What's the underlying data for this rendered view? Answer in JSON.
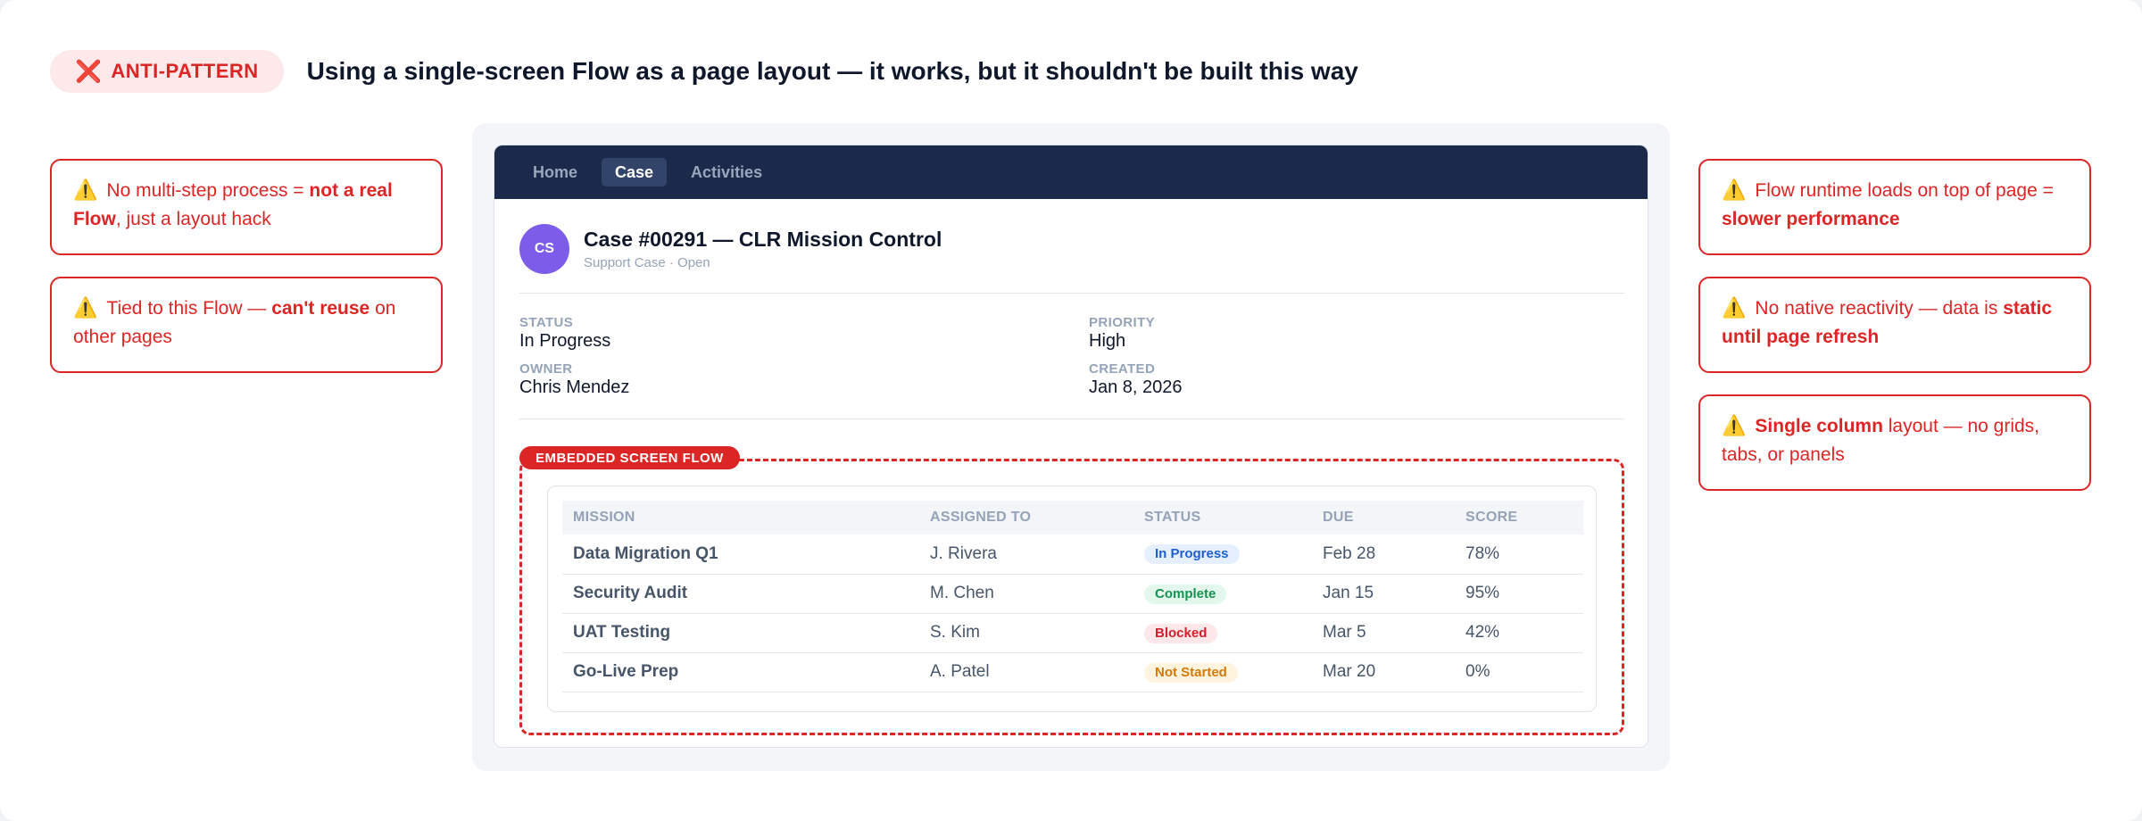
{
  "header": {
    "badge_icon": "❌",
    "badge_label": "ANTI-PATTERN",
    "title": "Using a single-screen Flow as a page layout — it works, but it shouldn't be built this way"
  },
  "warn_icon": "⚠️",
  "callouts_left": [
    {
      "pre": "No multi-step process = ",
      "bold": "not a real Flow",
      "post": ", just a layout hack"
    },
    {
      "pre": "Tied to this Flow — ",
      "bold": "can't reuse",
      "post": " on other pages"
    }
  ],
  "callouts_right": [
    {
      "pre": "Flow runtime loads on top of page = ",
      "bold": "slower performance",
      "post": ""
    },
    {
      "pre": "No native reactivity — data is ",
      "bold": "static until page refresh",
      "post": ""
    },
    {
      "pre": "",
      "bold": "Single column",
      "post": " layout — no grids, tabs, or panels"
    }
  ],
  "nav": {
    "tabs": [
      {
        "label": "Home",
        "active": false
      },
      {
        "label": "Case",
        "active": true
      },
      {
        "label": "Activities",
        "active": false
      }
    ]
  },
  "record": {
    "avatar": "CS",
    "title": "Case #00291 — CLR Mission Control",
    "subtitle": "Support Case · Open"
  },
  "fields": {
    "status": {
      "label": "STATUS",
      "value": "In Progress"
    },
    "priority": {
      "label": "PRIORITY",
      "value": "High"
    },
    "owner": {
      "label": "OWNER",
      "value": "Chris Mendez"
    },
    "created": {
      "label": "CREATED",
      "value": "Jan 8, 2026"
    }
  },
  "flow": {
    "tag": "EMBEDDED SCREEN FLOW",
    "columns": [
      "MISSION",
      "ASSIGNED TO",
      "STATUS",
      "DUE",
      "SCORE"
    ],
    "rows": [
      {
        "mission": "Data Migration Q1",
        "assigned": "J. Rivera",
        "status": "In Progress",
        "due": "Feb 28",
        "score": "78%"
      },
      {
        "mission": "Security Audit",
        "assigned": "M. Chen",
        "status": "Complete",
        "due": "Jan 15",
        "score": "95%"
      },
      {
        "mission": "UAT Testing",
        "assigned": "S. Kim",
        "status": "Blocked",
        "due": "Mar 5",
        "score": "42%"
      },
      {
        "mission": "Go-Live Prep",
        "assigned": "A. Patel",
        "status": "Not Started",
        "due": "Mar 20",
        "score": "0%"
      }
    ]
  },
  "status_colors": {
    "In Progress": {
      "bg": "#e6efff",
      "fg": "#1d5fd1"
    },
    "Complete": {
      "bg": "#e3f7ec",
      "fg": "#13924f"
    },
    "Blocked": {
      "bg": "#fde7e9",
      "fg": "#d21f2b"
    },
    "Not Started": {
      "bg": "#fff4dd",
      "fg": "#d27a05"
    }
  },
  "colors": {
    "accent_red": "#dc2626",
    "nav_bg": "#1b2a4a",
    "avatar_bg": "#7c5ce8"
  }
}
